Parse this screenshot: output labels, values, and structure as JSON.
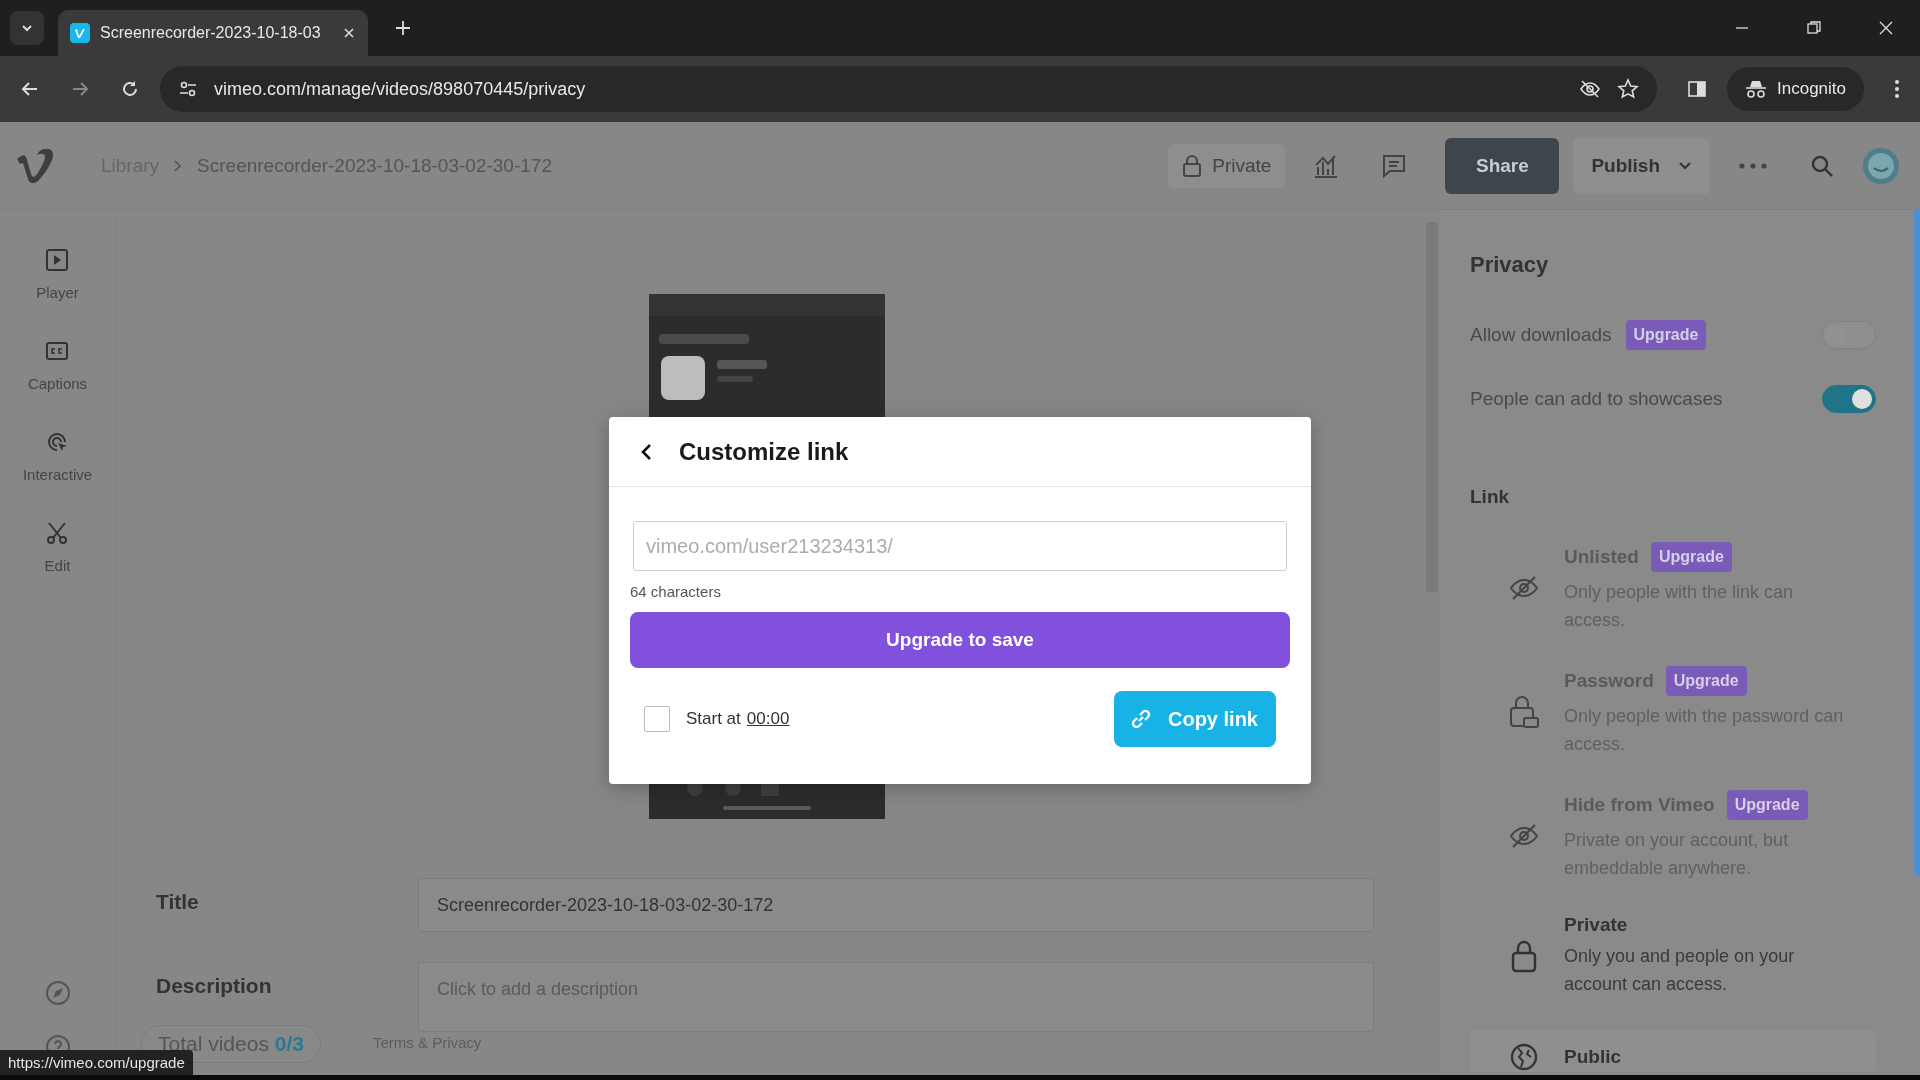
{
  "browser": {
    "tab_title": "Screenrecorder-2023-10-18-03",
    "url": "vimeo.com/manage/videos/898070445/privacy",
    "profile": "Incognito"
  },
  "header": {
    "breadcrumb": [
      "Library",
      "Screenrecorder-2023-10-18-03-02-30-172"
    ],
    "private_label": "Private",
    "share": "Share",
    "publish": "Publish"
  },
  "sidebar": {
    "items": [
      {
        "kind": "player",
        "label": "Player"
      },
      {
        "kind": "captions",
        "label": "Captions"
      },
      {
        "kind": "interactive",
        "label": "Interactive"
      },
      {
        "kind": "edit",
        "label": "Edit"
      }
    ]
  },
  "modal": {
    "title": "Customize link",
    "url_placeholder": "vimeo.com/user213234313/",
    "char_count": "64 characters",
    "upgrade_button": "Upgrade to save",
    "start_checked": false,
    "start_label": "Start at",
    "start_time": "00:00",
    "copy_button": "Copy link"
  },
  "form": {
    "title_label": "Title",
    "title_value": "Screenrecorder-2023-10-18-03-02-30-172",
    "description_label": "Description",
    "description_placeholder": "Click to add a description"
  },
  "footer": {
    "total_label": "Total videos",
    "total_value": "0/3",
    "terms": "Terms & Privacy"
  },
  "status_link": "https://vimeo.com/upgrade",
  "privacy": {
    "title": "Privacy",
    "toggles": [
      {
        "label": "Allow downloads",
        "badge": "Upgrade",
        "on": false
      },
      {
        "label": "People can add to showcases",
        "on": true
      }
    ],
    "link_heading": "Link",
    "options": [
      {
        "kind": "eye-off",
        "title": "Unlisted",
        "badge": "Upgrade",
        "description": "Only people with the link can access.",
        "selected": false
      },
      {
        "kind": "lock-key",
        "title": "Password",
        "badge": "Upgrade",
        "description": "Only people with the password can access.",
        "selected": false
      },
      {
        "kind": "eye-off",
        "title": "Hide from Vimeo",
        "badge": "Upgrade",
        "description": "Private on your account, but embeddable anywhere.",
        "selected": false
      },
      {
        "kind": "lock",
        "title": "Private",
        "description": "Only you and people on your account can access.",
        "selected": false
      },
      {
        "kind": "globe",
        "title": "Public",
        "selected": true
      }
    ]
  }
}
